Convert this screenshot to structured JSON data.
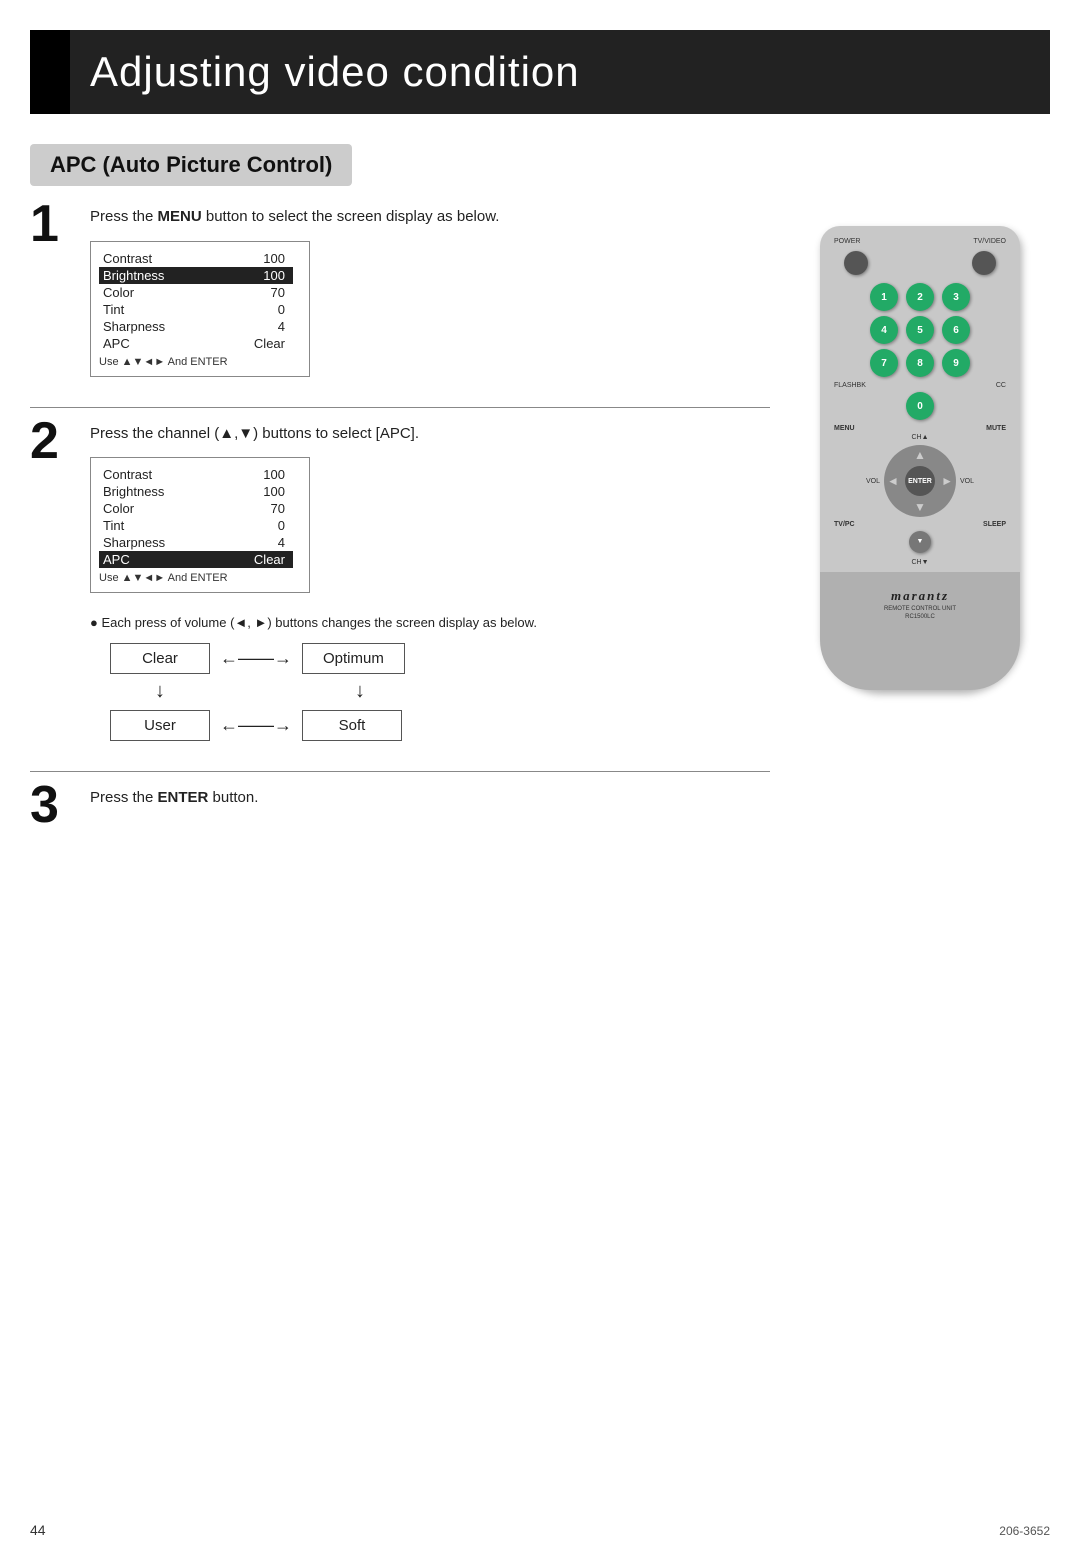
{
  "header": {
    "title": "Adjusting video condition"
  },
  "section": {
    "title": "APC (Auto Picture Control)"
  },
  "steps": [
    {
      "number": "1",
      "text_before": "Press the ",
      "bold_word": "MENU",
      "text_after": " button to select the screen display as below.",
      "menu": {
        "rows": [
          {
            "label": "Contrast",
            "value": "100",
            "highlighted": false
          },
          {
            "label": "Brightness",
            "value": "100",
            "highlighted": true
          },
          {
            "label": "Color",
            "value": "70",
            "highlighted": false
          },
          {
            "label": "Tint",
            "value": "0",
            "highlighted": false
          },
          {
            "label": "Sharpness",
            "value": "4",
            "highlighted": false
          },
          {
            "label": "APC",
            "value": "Clear",
            "highlighted": false
          }
        ],
        "hint": "Use ▲▼◄► And ENTER"
      }
    },
    {
      "number": "2",
      "text": "Press the channel (▲,▼) buttons to select [APC].",
      "menu": {
        "rows": [
          {
            "label": "Contrast",
            "value": "100",
            "highlighted": false
          },
          {
            "label": "Brightness",
            "value": "100",
            "highlighted": false
          },
          {
            "label": "Color",
            "value": "70",
            "highlighted": false
          },
          {
            "label": "Tint",
            "value": "0",
            "highlighted": false
          },
          {
            "label": "Sharpness",
            "value": "4",
            "highlighted": false
          },
          {
            "label": "APC",
            "value": "Clear",
            "highlighted": true
          }
        ],
        "hint": "Use ▲▼◄► And ENTER"
      },
      "note": "Each press of volume (◄, ►) buttons changes the screen display as below.",
      "modes": {
        "clear": "Clear",
        "optimum": "Optimum",
        "user": "User",
        "soft": "Soft"
      }
    },
    {
      "number": "3",
      "text_before": "Press the ",
      "bold_word": "ENTER",
      "text_after": " button."
    }
  ],
  "remote": {
    "brand": "marantz",
    "model_label": "REMOTE CONTROL UNIT",
    "model_number": "RC1500LC",
    "buttons": {
      "power": "POWER",
      "tv_video": "TV/VIDEO",
      "num1": "1",
      "num2": "2",
      "num3": "3",
      "num4": "4",
      "num5": "5",
      "num6": "6",
      "num7": "7",
      "num8": "8",
      "num9": "9",
      "flashbk": "FLASHBK",
      "cc": "CC",
      "num0": "0",
      "menu": "MENU",
      "mute": "MUTE",
      "ch_up": "CH▲",
      "vol_left": "VOL",
      "enter": "ENTER",
      "vol_right": "VOL",
      "tv_pc": "TV/PC",
      "sleep": "SLEEP",
      "ch_down": "CH▼"
    }
  },
  "footer": {
    "page_number": "44",
    "doc_number": "206-3652"
  }
}
